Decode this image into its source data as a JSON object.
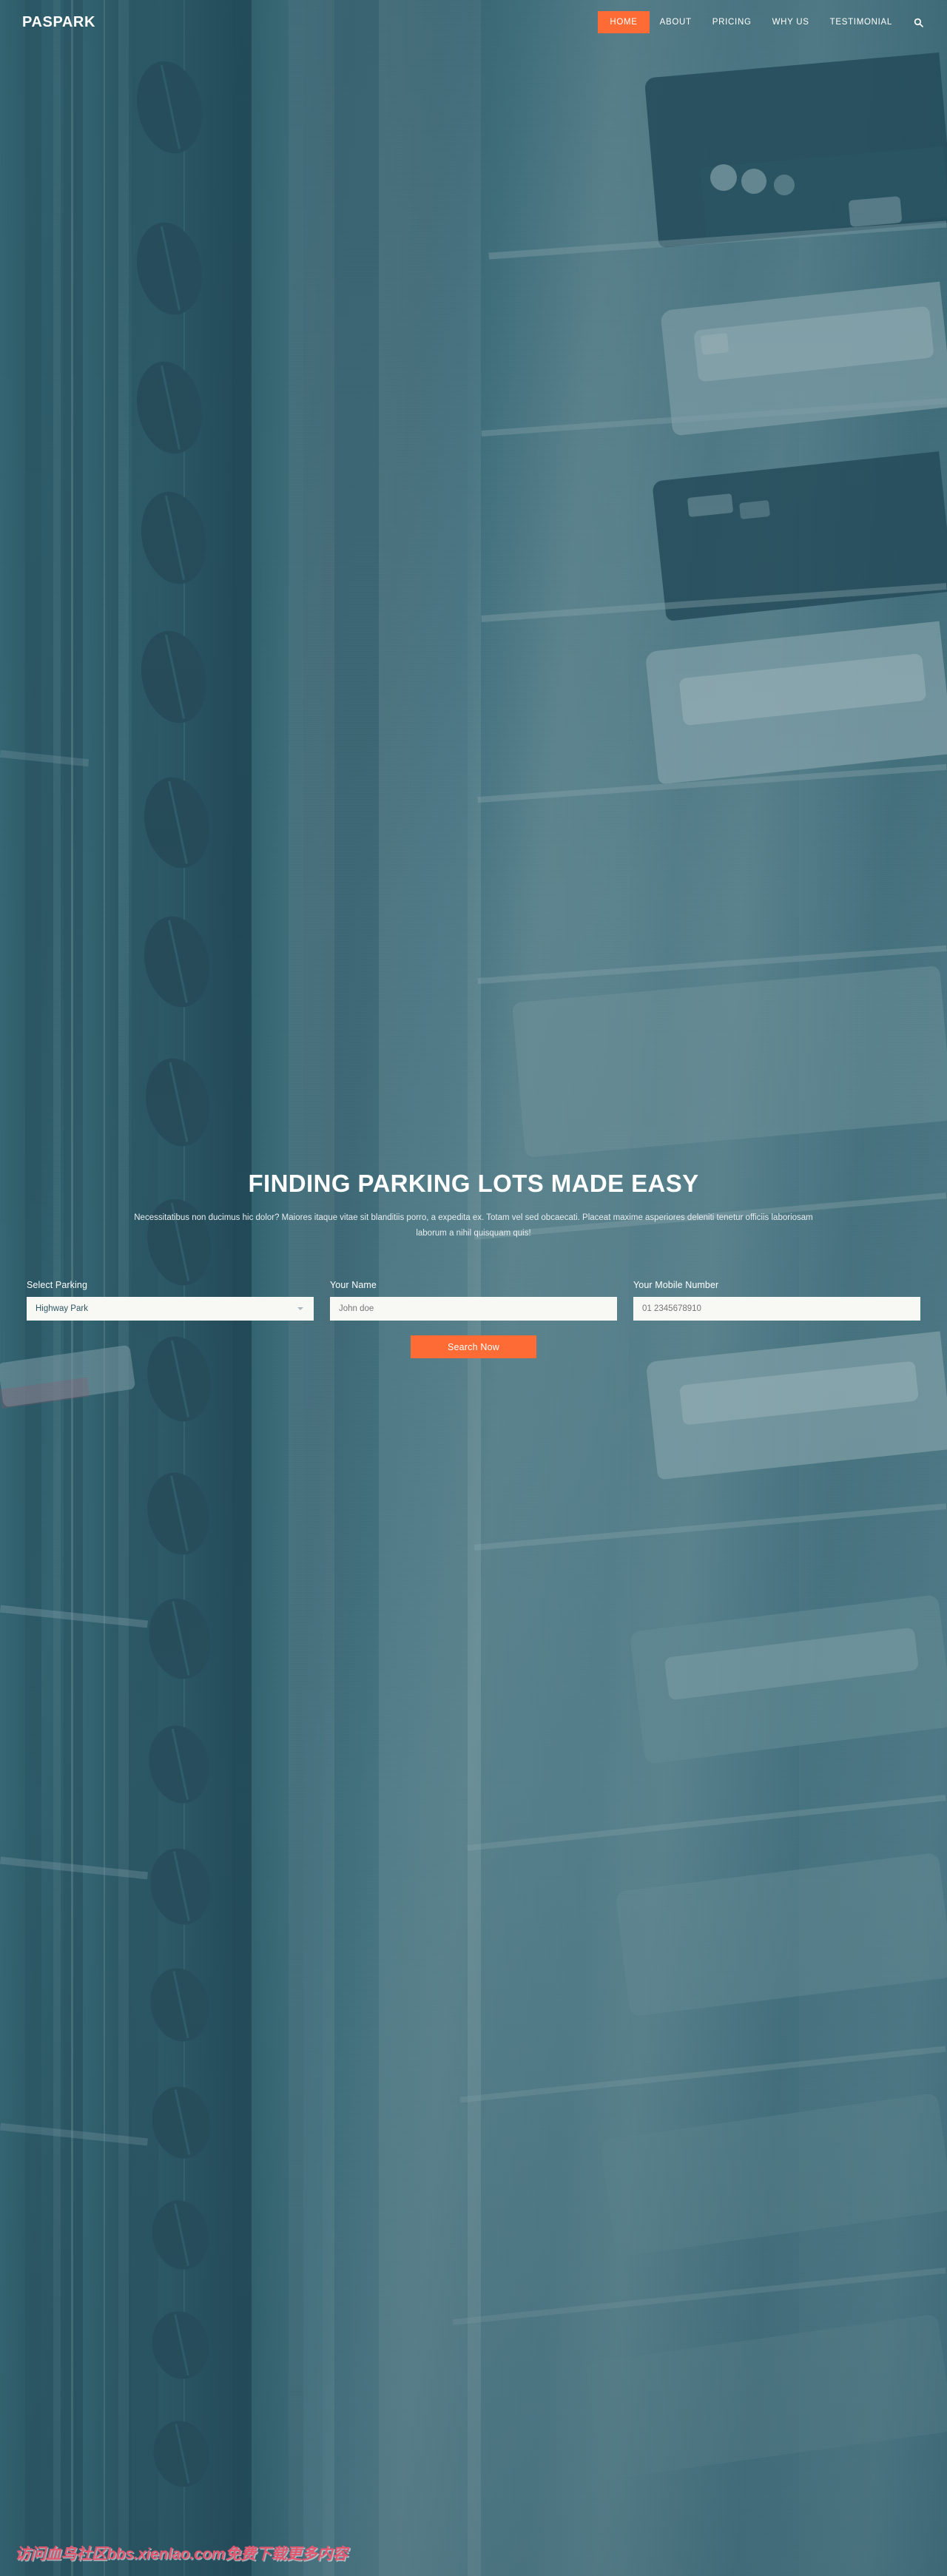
{
  "site": {
    "logo": "PASPARK",
    "accent_color": "#ff6b35",
    "overlay_color": "#2d5663",
    "field_background": "#f8f8f4"
  },
  "navbar": {
    "items": [
      {
        "label": "HOME",
        "active": true
      },
      {
        "label": "ABOUT",
        "active": false
      },
      {
        "label": "PRICING",
        "active": false
      },
      {
        "label": "WHY US",
        "active": false
      },
      {
        "label": "TESTIMONIAL",
        "active": false
      }
    ],
    "search_icon": "search-icon"
  },
  "hero": {
    "title": "FINDING PARKING LOTS MADE EASY",
    "subtitle": "Necessitatibus non ducimus hic dolor? Maiores itaque vitae sit blanditiis porro, a expedita ex. Totam vel sed obcaecati. Placeat maxime asperiores deleniti tenetur officiis laboriosam laborum a nihil quisquam quis!"
  },
  "form": {
    "fields": [
      {
        "label": "Select Parking",
        "type": "select",
        "value": "Highway Park",
        "options": [
          "Highway Park"
        ]
      },
      {
        "label": "Your Name",
        "type": "text",
        "value": "",
        "placeholder": "John doe"
      },
      {
        "label": "Your Mobile Number",
        "type": "tel",
        "value": "",
        "placeholder": "01 2345678910"
      }
    ],
    "submit_label": "Search Now"
  },
  "watermark": {
    "text": "访问血鸟社区bbs.xienlao.com免费下载更多内容"
  }
}
